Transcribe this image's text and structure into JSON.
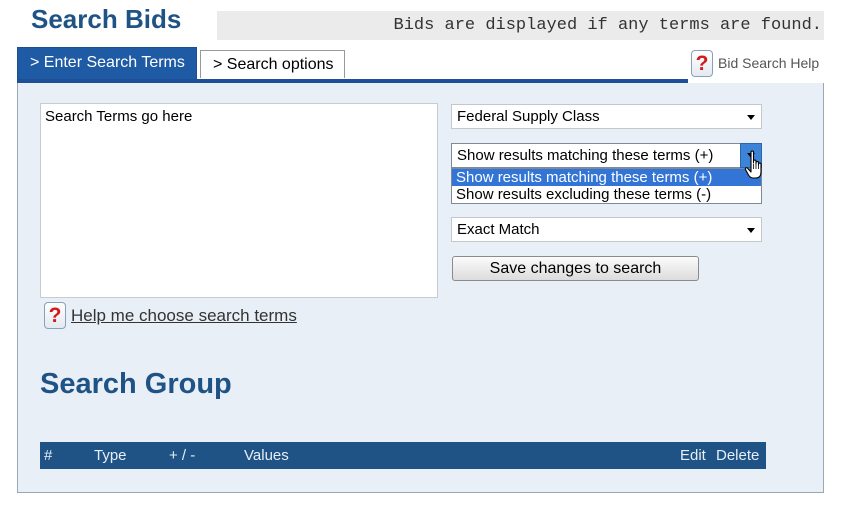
{
  "header": {
    "title": "Search Bids",
    "notice": "Bids are displayed if any terms are found."
  },
  "tabs": [
    {
      "label": "> Enter Search Terms",
      "active": true
    },
    {
      "label": "> Search options",
      "active": false
    }
  ],
  "help": {
    "bid_search_help": "Bid Search Help",
    "choose_terms": "Help me choose search terms",
    "icon_glyph": "?"
  },
  "search_terms": {
    "value": "Search Terms go here"
  },
  "selects": {
    "field": "Federal Supply Class",
    "match_mode": "Show results matching these terms (+)",
    "match_options": [
      "Show results matching these terms (+)",
      "Show results excluding these terms (-)"
    ],
    "match_type": "Exact Match"
  },
  "buttons": {
    "save": "Save changes to search"
  },
  "search_group": {
    "title": "Search Group",
    "columns": [
      "#",
      "Type",
      "+ / -",
      "Values",
      "Edit",
      "Delete"
    ]
  },
  "colors": {
    "brand_blue": "#1f5385",
    "tab_active": "#1f5ba4",
    "panel_bg": "#e8eff7",
    "selection": "#3375d6"
  }
}
